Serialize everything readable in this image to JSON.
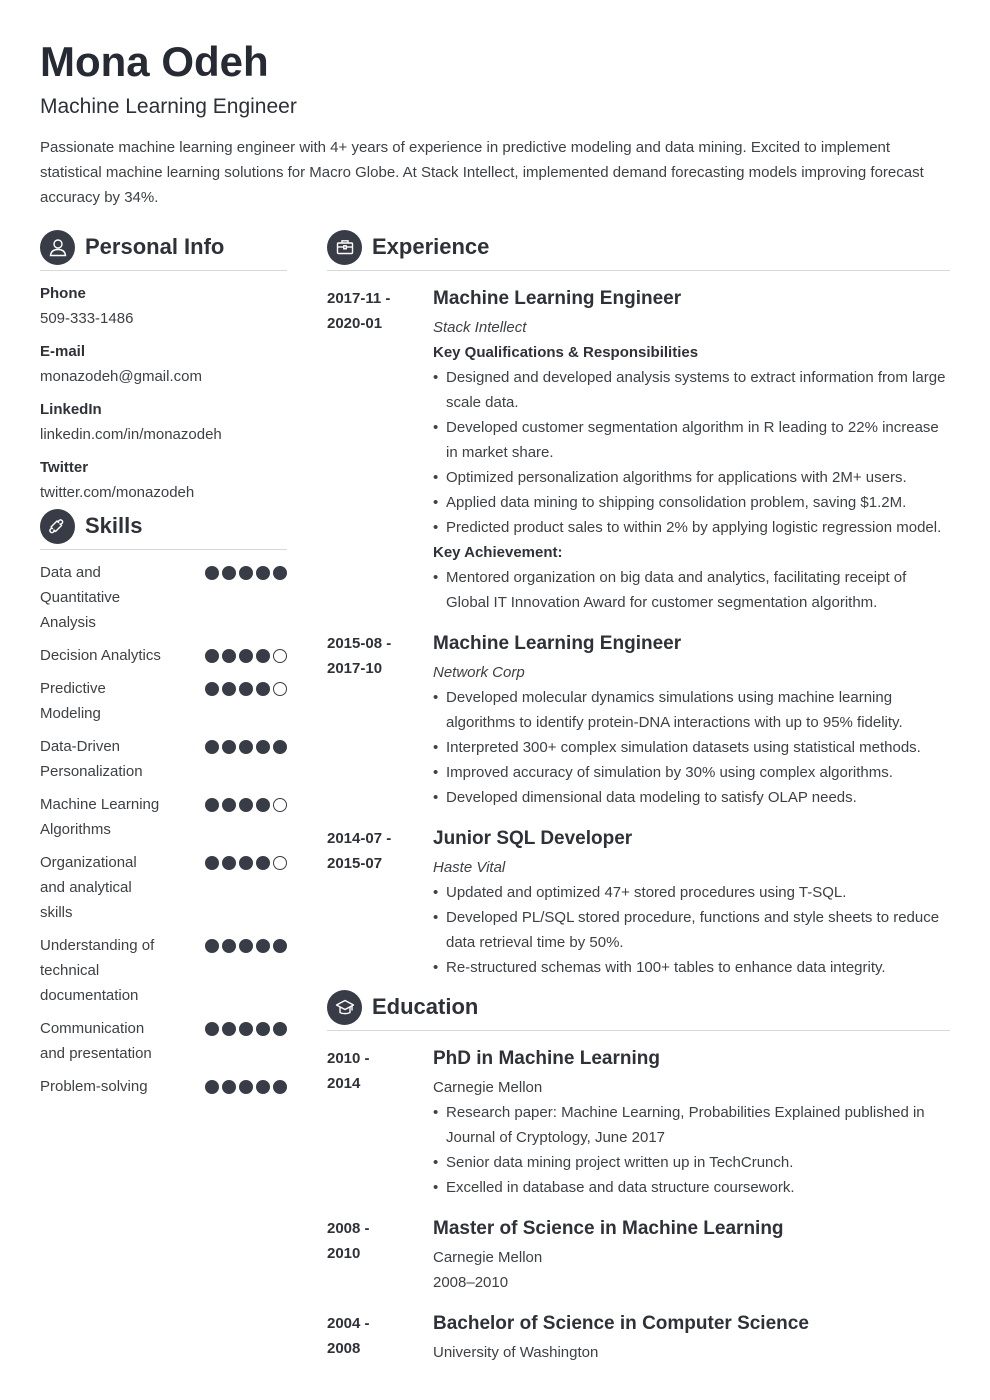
{
  "header": {
    "name": "Mona Odeh",
    "role": "Machine Learning Engineer",
    "summary": "Passionate machine learning engineer with 4+ years of experience in predictive modeling and data mining. Excited to implement statistical machine learning solutions for Macro Globe. At Stack Intellect, implemented demand forecasting models improving forecast accuracy by 34%."
  },
  "personal_info": {
    "title": "Personal Info",
    "icon": "user-icon",
    "items": [
      {
        "label": "Phone",
        "value": "509-333-1486"
      },
      {
        "label": "E-mail",
        "value": "monazodeh@gmail.com"
      },
      {
        "label": "LinkedIn",
        "value": "linkedin.com/in/monazodeh"
      },
      {
        "label": "Twitter",
        "value": "twitter.com/monazodeh"
      }
    ]
  },
  "skills": {
    "title": "Skills",
    "icon": "puzzle-icon",
    "max_level": 5,
    "items": [
      {
        "name": "Data and Quantitative Analysis",
        "level": 5
      },
      {
        "name": "Decision Analytics",
        "level": 4
      },
      {
        "name": "Predictive Modeling",
        "level": 4
      },
      {
        "name": "Data-Driven Personalization",
        "level": 5
      },
      {
        "name": "Machine Learning Algorithms",
        "level": 4
      },
      {
        "name": "Organizational and analytical skills",
        "level": 4
      },
      {
        "name": "Understanding of technical documentation",
        "level": 5
      },
      {
        "name": "Communication and presentation",
        "level": 5
      },
      {
        "name": "Problem-solving",
        "level": 5
      }
    ]
  },
  "experience": {
    "title": "Experience",
    "icon": "briefcase-icon",
    "entries": [
      {
        "dates_start": "2017-11 -",
        "dates_end": "2020-01",
        "title": "Machine Learning Engineer",
        "company": "Stack Intellect",
        "subhead1": "Key Qualifications & Responsibilities",
        "bullets": [
          "Designed and developed analysis systems to extract information from large scale data.",
          "Developed customer segmentation algorithm in R leading to 22% increase in market share.",
          "Optimized personalization algorithms for applications with 2M+ users.",
          "Applied data mining to shipping consolidation problem, saving $1.2M.",
          "Predicted product sales to within 2% by applying logistic regression model."
        ],
        "subhead2": "Key Achievement:",
        "bullets2": [
          "Mentored organization on big data and analytics, facilitating receipt of Global IT Innovation Award for customer segmentation algorithm."
        ]
      },
      {
        "dates_start": "2015-08 -",
        "dates_end": "2017-10",
        "title": "Machine Learning Engineer",
        "company": "Network Corp",
        "bullets": [
          "Developed molecular dynamics simulations using machine learning algorithms to identify protein-DNA interactions with up to 95% fidelity.",
          "Interpreted 300+ complex simulation datasets using statistical methods.",
          "Improved accuracy of simulation by 30% using complex algorithms.",
          "Developed dimensional data modeling to satisfy OLAP needs."
        ]
      },
      {
        "dates_start": "2014-07 -",
        "dates_end": "2015-07",
        "title": "Junior SQL Developer",
        "company": "Haste Vital",
        "bullets": [
          "Updated and optimized 47+ stored procedures using T-SQL.",
          "Developed PL/SQL stored procedure, functions and style sheets to reduce data retrieval time by 50%.",
          "Re-structured schemas with 100+ tables to enhance data integrity."
        ]
      }
    ]
  },
  "education": {
    "title": "Education",
    "icon": "graduation-cap-icon",
    "entries": [
      {
        "dates_start": "2010 -",
        "dates_end": "2014",
        "title": "PhD in Machine Learning",
        "school": "Carnegie Mellon",
        "bullets": [
          "Research paper: Machine Learning, Probabilities Explained published in Journal of Cryptology, June 2017",
          "Senior data mining project written up in TechCrunch.",
          "Excelled in database and data structure coursework."
        ]
      },
      {
        "dates_start": "2008 -",
        "dates_end": "2010",
        "title": "Master of Science in Machine Learning",
        "school": "Carnegie Mellon",
        "extra": "2008–2010"
      },
      {
        "dates_start": "2004 -",
        "dates_end": "2008",
        "title": "Bachelor of Science in Computer Science",
        "school": "University of Washington"
      }
    ]
  }
}
